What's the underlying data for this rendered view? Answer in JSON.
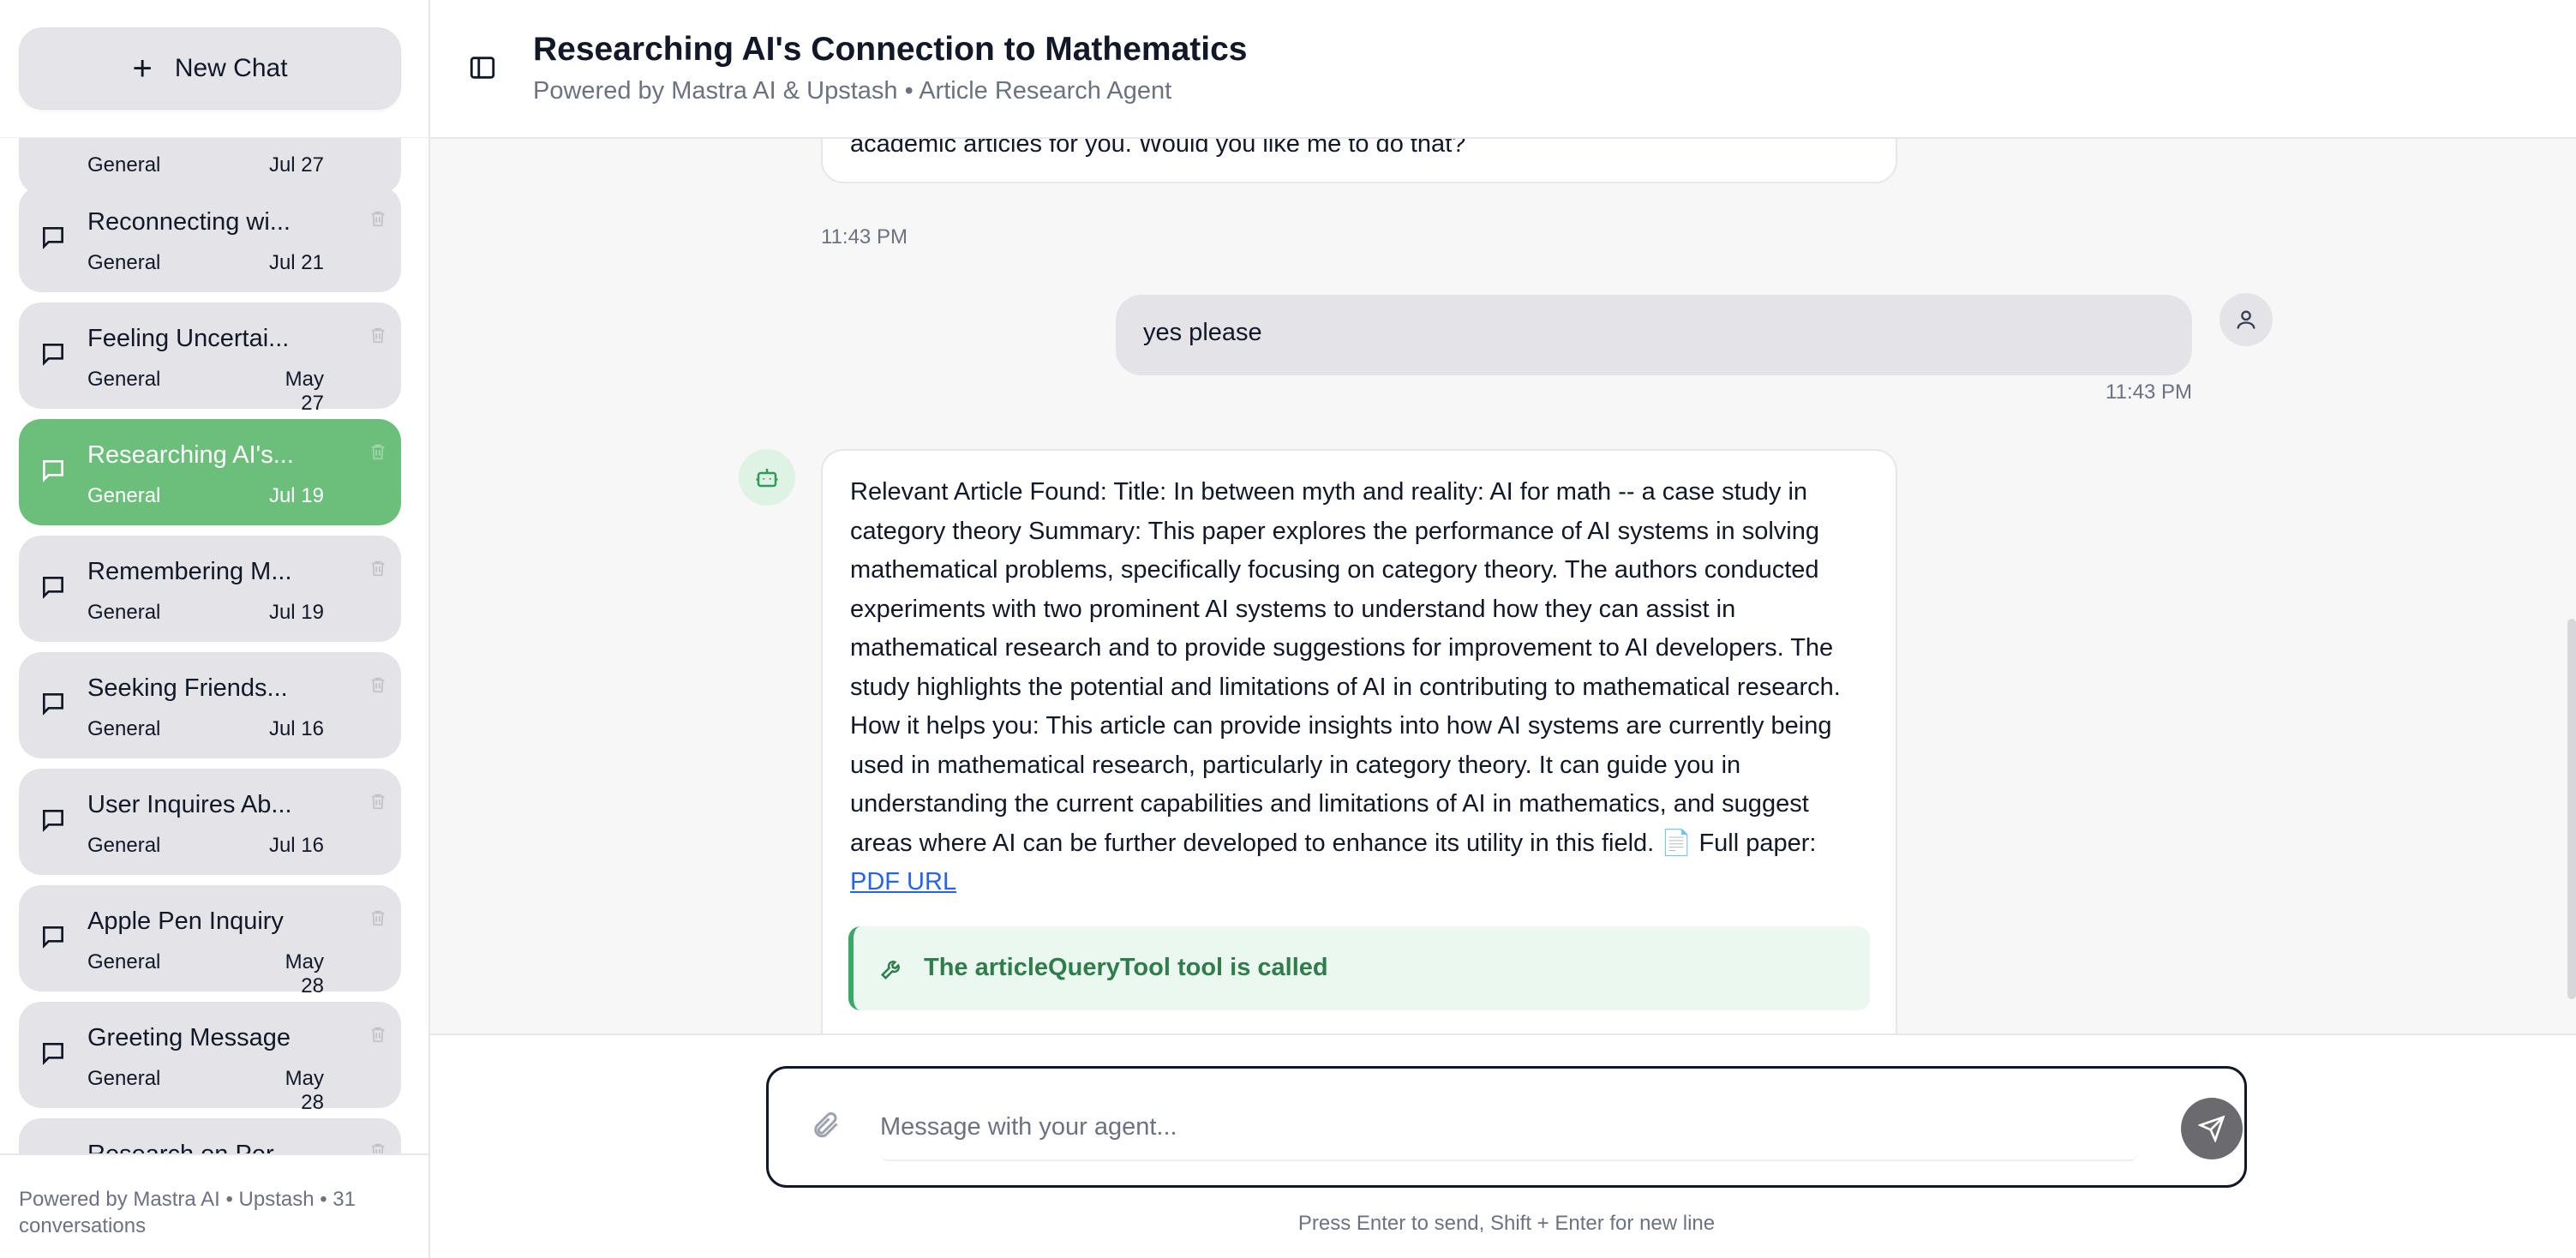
{
  "sidebar": {
    "new_chat_label": "New Chat",
    "conversations": [
      {
        "title": "",
        "category": "General",
        "date": "Jul 27"
      },
      {
        "title": "Reconnecting wi...",
        "category": "General",
        "date": "Jul 21"
      },
      {
        "title": "Feeling Uncertai...",
        "category": "General",
        "date": "May 27"
      },
      {
        "title": "Researching AI's...",
        "category": "General",
        "date": "Jul 19",
        "active": true
      },
      {
        "title": "Remembering M...",
        "category": "General",
        "date": "Jul 19"
      },
      {
        "title": "Seeking Friends...",
        "category": "General",
        "date": "Jul 16"
      },
      {
        "title": "User Inquires Ab...",
        "category": "General",
        "date": "Jul 16"
      },
      {
        "title": "Apple Pen Inquiry",
        "category": "General",
        "date": "May 28"
      },
      {
        "title": "Greeting Message",
        "category": "General",
        "date": "May 28"
      },
      {
        "title": "Research on Per...",
        "category": "",
        "date": ""
      }
    ],
    "footer": "Powered by Mastra AI • Upstash • 31 conversations"
  },
  "header": {
    "title": "Researching AI's Connection to Mathematics",
    "subtitle": "Powered by Mastra AI & Upstash • Article Research Agent"
  },
  "messages": {
    "ai_1_text": "academic articles for you. Would you like me to do that?",
    "ai_1_time": "11:43 PM",
    "user_text": "yes please",
    "user_time": "11:43 PM",
    "ai_2_text": "Relevant Article Found: Title: In between myth and reality: AI for math -- a case study in category theory Summary: This paper explores the performance of AI systems in solving mathematical problems, specifically focusing on category theory. The authors conducted experiments with two prominent AI systems to understand how they can assist in mathematical research and to provide suggestions for improvement to AI developers. The study highlights the potential and limitations of AI in contributing to mathematical research. How it helps you: This article can provide insights into how AI systems are currently being used in mathematical research, particularly in category theory. It can guide you in understanding the current capabilities and limitations of AI in mathematics, and suggest areas where AI can be further developed to enhance its utility in this field. 📄 Full paper: ",
    "ai_2_link": "PDF URL",
    "tool_callout": "The articleQueryTool tool is called"
  },
  "input": {
    "placeholder": "Message with your agent...",
    "hint": "Press Enter to send, Shift + Enter for new line"
  },
  "colors": {
    "accent_green": "#6bbf7a",
    "link_blue": "#2563eb",
    "tool_green": "#2f7d4b"
  }
}
